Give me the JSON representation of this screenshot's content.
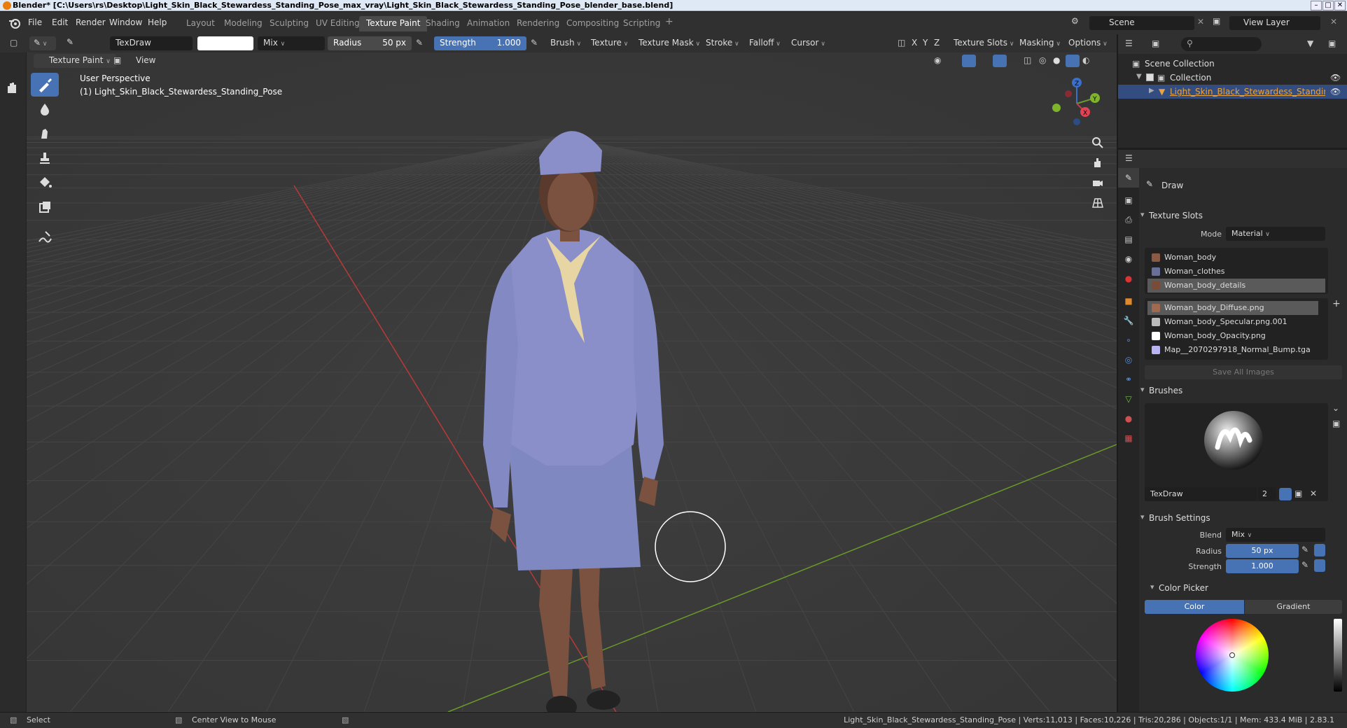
{
  "window": {
    "title": "Blender* [C:\\Users\\rs\\Desktop\\Light_Skin_Black_Stewardess_Standing_Pose_max_vray\\Light_Skin_Black_Stewardess_Standing_Pose_blender_base.blend]"
  },
  "menu": [
    "File",
    "Edit",
    "Render",
    "Window",
    "Help"
  ],
  "workspaces": [
    {
      "label": "Layout",
      "active": false
    },
    {
      "label": "Modeling",
      "active": false
    },
    {
      "label": "Sculpting",
      "active": false
    },
    {
      "label": "UV Editing",
      "active": false
    },
    {
      "label": "Texture Paint",
      "active": true
    },
    {
      "label": "Shading",
      "active": false
    },
    {
      "label": "Animation",
      "active": false
    },
    {
      "label": "Rendering",
      "active": false
    },
    {
      "label": "Compositing",
      "active": false
    },
    {
      "label": "Scripting",
      "active": false
    }
  ],
  "scene": {
    "name": "Scene",
    "view_layer": "View Layer"
  },
  "tool_header": {
    "brush_name": "TexDraw",
    "blend": "Mix",
    "radius_label": "Radius",
    "radius_value": "50 px",
    "strength_label": "Strength",
    "strength_value": "1.000",
    "menus": [
      "Brush",
      "Texture",
      "Texture Mask",
      "Stroke",
      "Falloff",
      "Cursor"
    ],
    "axes": [
      "X",
      "Y",
      "Z"
    ],
    "right_menus": [
      "Texture Slots",
      "Masking",
      "Options"
    ]
  },
  "view_header": {
    "mode": "Texture Paint",
    "view": "View"
  },
  "viewport": {
    "perspective": "User Perspective",
    "object_label": "(1) Light_Skin_Black_Stewardess_Standing_Pose"
  },
  "outliner": {
    "scene_collection": "Scene Collection",
    "collection": "Collection",
    "object": "Light_Skin_Black_Stewardess_Standing_Pose"
  },
  "properties": {
    "tool_name": "Draw",
    "texture_slots": {
      "title": "Texture Slots",
      "mode_label": "Mode",
      "mode_value": "Material",
      "materials": [
        {
          "name": "Woman_body",
          "selected": false,
          "color": "#8a5a44"
        },
        {
          "name": "Woman_clothes",
          "selected": false,
          "color": "#6a6f9a"
        },
        {
          "name": "Woman_body_details",
          "selected": true,
          "color": "#7a4c38"
        }
      ],
      "images": [
        {
          "name": "Woman_body_Diffuse.png",
          "selected": true,
          "color": "#a06a50"
        },
        {
          "name": "Woman_body_Specular.png.001",
          "selected": false,
          "color": "#bcbcbc"
        },
        {
          "name": "Woman_body_Opacity.png",
          "selected": false,
          "color": "#ffffff"
        },
        {
          "name": "Map__2070297918_Normal_Bump.tga",
          "selected": false,
          "color": "#b9b4f2"
        }
      ],
      "save_all": "Save All Images"
    },
    "brushes": {
      "title": "Brushes",
      "brush_name": "TexDraw",
      "users": "2"
    },
    "brush_settings": {
      "title": "Brush Settings",
      "blend_label": "Blend",
      "blend_value": "Mix",
      "radius_label": "Radius",
      "radius_value": "50 px",
      "strength_label": "Strength",
      "strength_value": "1.000"
    },
    "color_picker": {
      "title": "Color Picker",
      "tab_color": "Color",
      "tab_gradient": "Gradient"
    }
  },
  "statusbar": {
    "select": "Select",
    "center": "Center View to Mouse",
    "stats": "Light_Skin_Black_Stewardess_Standing_Pose | Verts:11,013 | Faces:10,226 | Tris:20,286 | Objects:1/1 | Mem: 433.4 MiB | 2.83.1"
  },
  "colors": {
    "accent": "#4772b3",
    "uniform": "#8a8fc9",
    "scarf": "#e7d6a4",
    "skin": "#7b5140",
    "x_axis": "#b83a3a",
    "y_axis": "#6a9a2a"
  }
}
